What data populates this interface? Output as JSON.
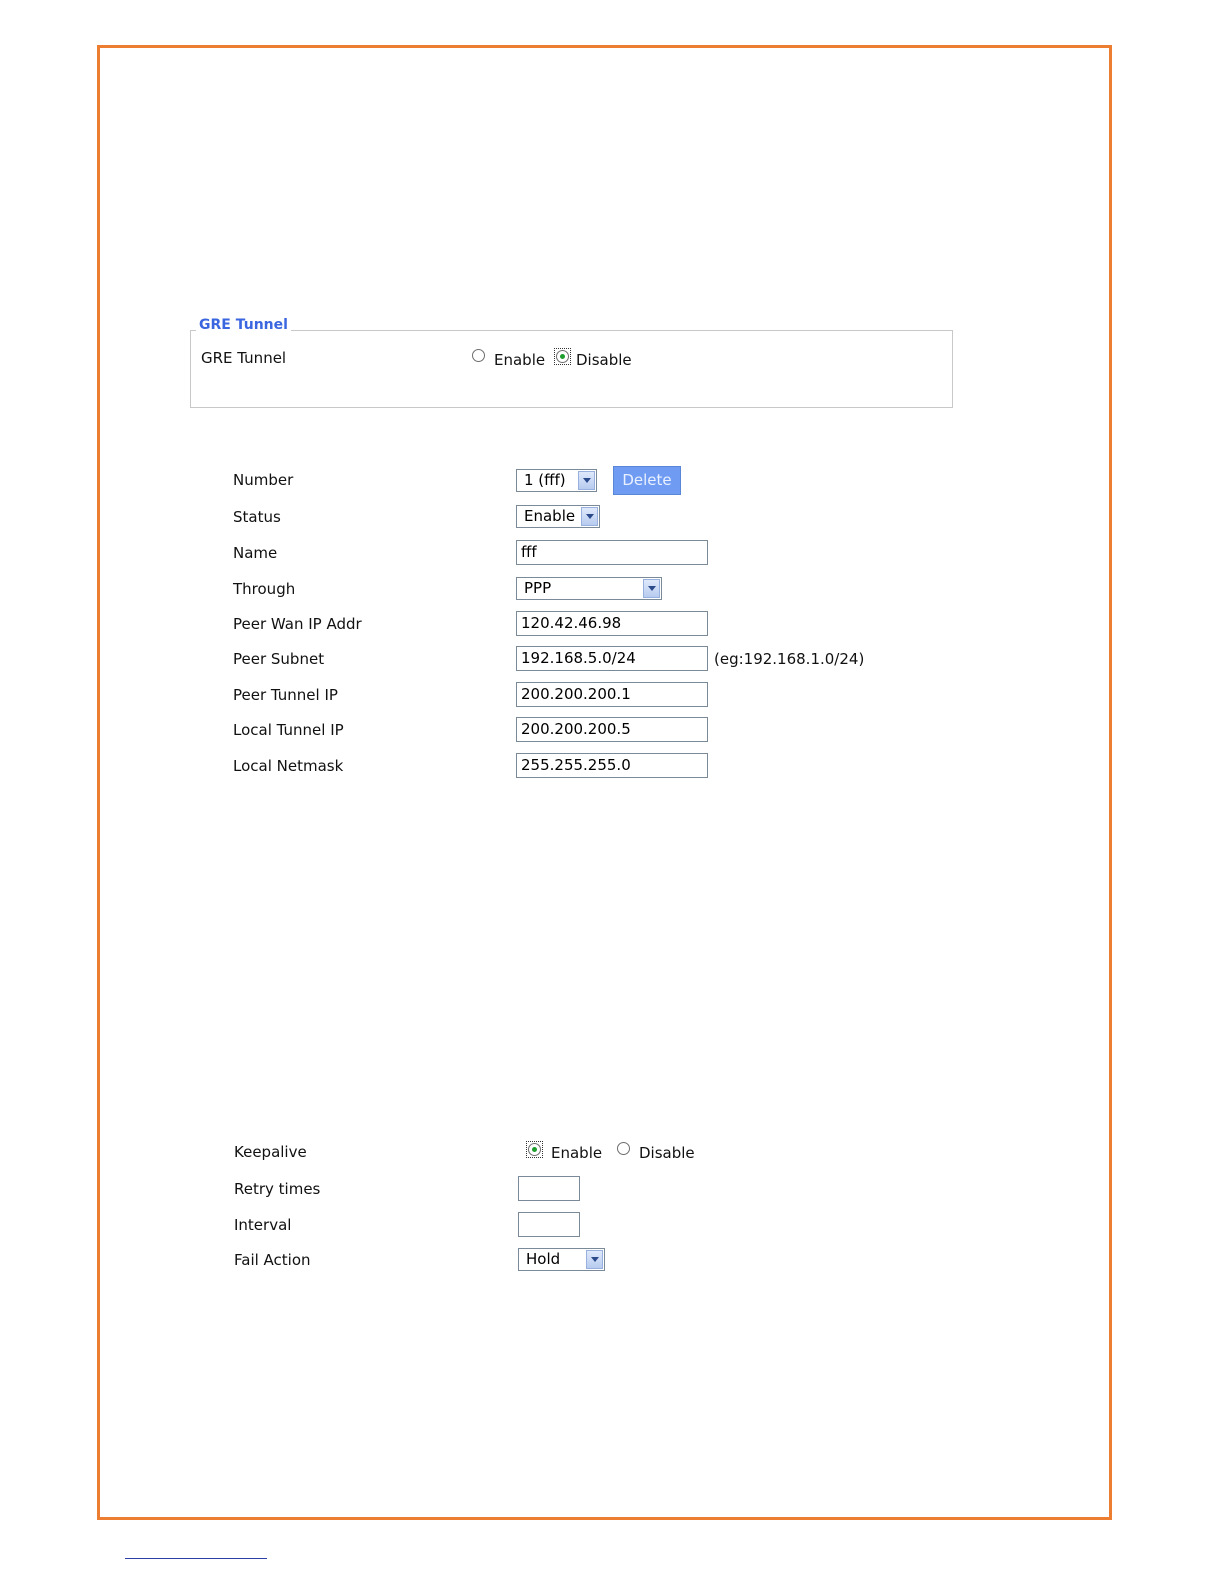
{
  "gre_section": {
    "legend": "GRE Tunnel",
    "label": "GRE Tunnel",
    "options": [
      {
        "label": "Enable",
        "checked": false
      },
      {
        "label": "Disable",
        "checked": true
      }
    ]
  },
  "tunnel_form": {
    "number": {
      "label": "Number",
      "value": "1 (fff)",
      "delete_label": "Delete"
    },
    "status": {
      "label": "Status",
      "value": "Enable"
    },
    "name": {
      "label": "Name",
      "value": "fff"
    },
    "through": {
      "label": "Through",
      "value": "PPP"
    },
    "peer_wan_ip": {
      "label": "Peer Wan IP Addr",
      "value": "120.42.46.98"
    },
    "peer_subnet": {
      "label": "Peer Subnet",
      "value": "192.168.5.0/24",
      "hint": "(eg:192.168.1.0/24)"
    },
    "peer_tunnel_ip": {
      "label": "Peer Tunnel IP",
      "value": "200.200.200.1"
    },
    "local_tunnel_ip": {
      "label": "Local Tunnel IP",
      "value": "200.200.200.5"
    },
    "local_netmask": {
      "label": "Local Netmask",
      "value": "255.255.255.0"
    }
  },
  "keepalive_form": {
    "keepalive": {
      "label": "Keepalive",
      "options": [
        {
          "label": "Enable",
          "checked": true
        },
        {
          "label": "Disable",
          "checked": false
        }
      ]
    },
    "retry_times": {
      "label": "Retry times",
      "value": ""
    },
    "interval": {
      "label": "Interval",
      "value": ""
    },
    "fail_action": {
      "label": "Fail Action",
      "value": "Hold"
    }
  },
  "colors": {
    "frame": "#ed7d31",
    "legend": "#3a66e0",
    "delete_button": "#6f9cf2",
    "radio_checked": "#1e9e2e"
  }
}
